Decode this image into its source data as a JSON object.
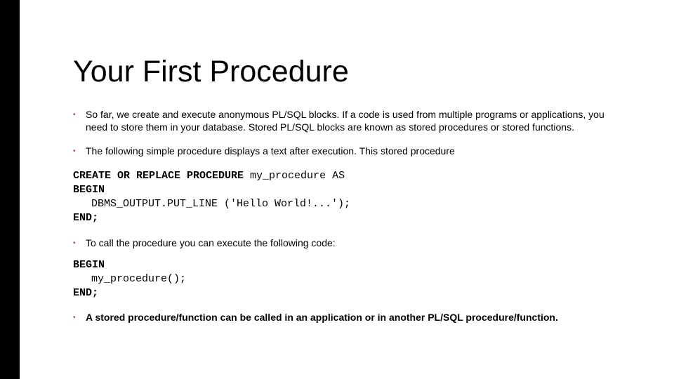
{
  "title": "Your First Procedure",
  "bullets": {
    "b1": "So far, we create and execute anonymous PL/SQL blocks. If a code is used from multiple programs or applications, you need to store them in your database. Stored PL/SQL blocks are known as stored procedures or stored functions.",
    "b2": "The following simple procedure displays a text after execution. This stored procedure",
    "b3": "To call the procedure you can execute the following code:",
    "b4": "A stored procedure/function can be called in an application or in another PL/SQL procedure/function."
  },
  "code1": {
    "line1a": "CREATE OR REPLACE PROCEDURE ",
    "line1b": "my_procedure AS",
    "line2": "BEGIN",
    "line3": "DBMS_OUTPUT.PUT_LINE ('Hello World!...');",
    "line4": "END;"
  },
  "code2": {
    "line1": "BEGIN",
    "line2": "my_procedure();",
    "line3": "END;"
  },
  "bullet_glyph": "•"
}
